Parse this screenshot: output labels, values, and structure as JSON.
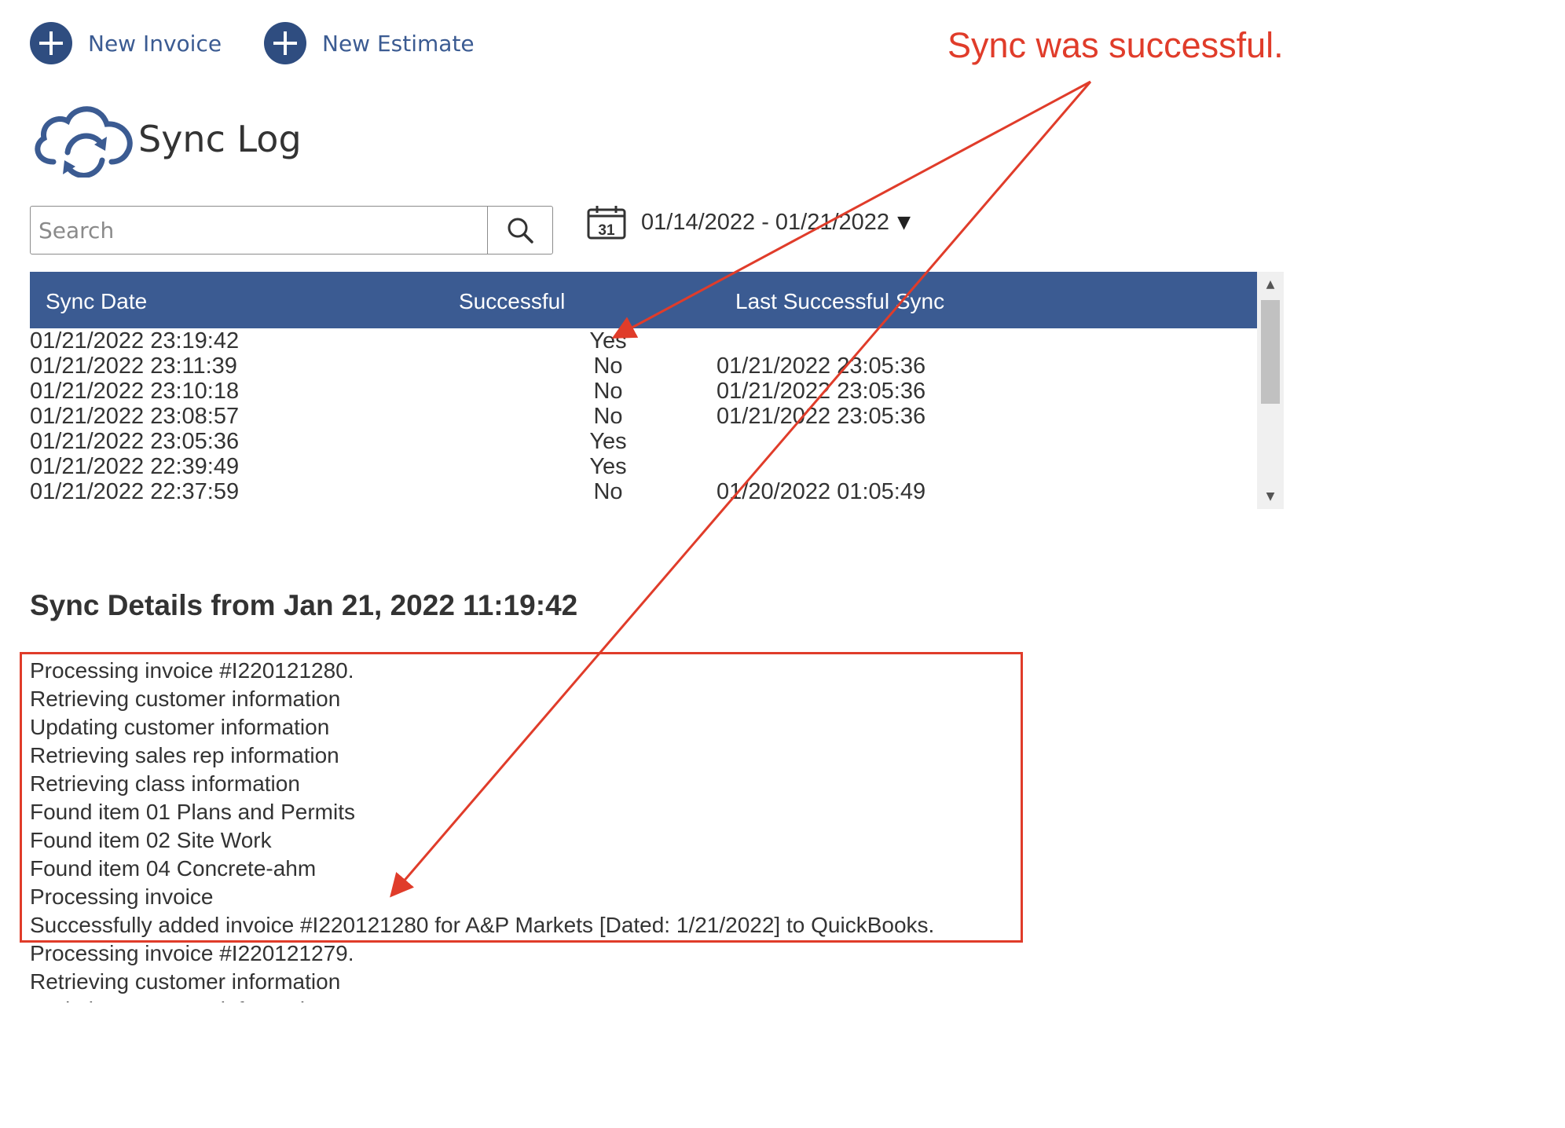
{
  "header": {
    "new_invoice_label": "New Invoice",
    "new_estimate_label": "New Estimate"
  },
  "page": {
    "title": "Sync Log"
  },
  "search": {
    "placeholder": "Search"
  },
  "date_filter": {
    "range": "01/14/2022 - 01/21/2022",
    "calendar_day": "31"
  },
  "table": {
    "headers": {
      "sync_date": "Sync Date",
      "successful": "Successful",
      "last_successful_sync": "Last Successful Sync"
    },
    "rows": [
      {
        "sync_date": "01/21/2022 23:19:42",
        "successful": "Yes",
        "last_successful_sync": ""
      },
      {
        "sync_date": "01/21/2022 23:11:39",
        "successful": "No",
        "last_successful_sync": "01/21/2022 23:05:36"
      },
      {
        "sync_date": "01/21/2022 23:10:18",
        "successful": "No",
        "last_successful_sync": "01/21/2022 23:05:36"
      },
      {
        "sync_date": "01/21/2022 23:08:57",
        "successful": "No",
        "last_successful_sync": "01/21/2022 23:05:36"
      },
      {
        "sync_date": "01/21/2022 23:05:36",
        "successful": "Yes",
        "last_successful_sync": ""
      },
      {
        "sync_date": "01/21/2022 22:39:49",
        "successful": "Yes",
        "last_successful_sync": ""
      },
      {
        "sync_date": "01/21/2022 22:37:59",
        "successful": "No",
        "last_successful_sync": "01/20/2022 01:05:49"
      }
    ]
  },
  "details": {
    "title": "Sync Details from Jan 21, 2022 11:19:42",
    "lines": [
      "Processing invoice #I220121280.",
      "Retrieving customer information",
      "Updating customer information",
      "Retrieving sales rep information",
      "Retrieving class information",
      "Found item 01 Plans and Permits",
      "Found item 02 Site Work",
      "Found item 04 Concrete-ahm",
      "Processing invoice",
      "Successfully added invoice #I220121280 for A&P Markets [Dated: 1/21/2022] to QuickBooks.",
      "Processing invoice #I220121279.",
      "Retrieving customer information",
      "Updating customer information"
    ]
  },
  "annotation": {
    "text": "Sync was successful."
  },
  "colors": {
    "brand_blue": "#3b5b92",
    "header_blue": "#3b5b92",
    "annotation_red": "#e03c2a"
  }
}
